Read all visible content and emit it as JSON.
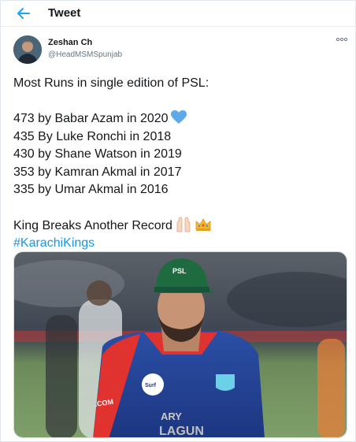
{
  "header": {
    "title": "Tweet"
  },
  "author": {
    "name": "Zeshan Ch",
    "handle": "@HeadMSMSpunjab"
  },
  "tweet": {
    "lines": [
      "Most Runs in single edition of PSL:",
      "",
      "473 by Babar Azam in 2020",
      "435 By Luke Ronchi in 2018",
      "430 by Shane Watson in 2019",
      "353 by Kamran Akmal in 2017",
      "335 by Umar Akmal in 2016",
      "",
      "King Breaks Another Record",
      "#KarachiKings"
    ],
    "hashtag": "#KarachiKings"
  },
  "media": {
    "cap_text": "PSL",
    "jersey_text_1": "ARY",
    "jersey_text_2": "LAGUN",
    "sponsor_text": "Surf",
    "side_text": ".COM"
  },
  "colors": {
    "link": "#1b95e0",
    "heart": "#5da9e9",
    "text": "#14171a",
    "muted": "#657786"
  }
}
